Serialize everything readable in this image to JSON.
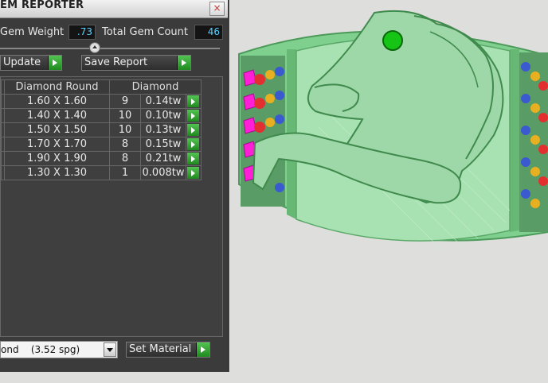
{
  "panel": {
    "title": "EM REPORTER",
    "close": "×",
    "gem_weight_label": "Gem Weight",
    "gem_weight_value": ".73",
    "gem_count_label": "Total Gem Count",
    "gem_count_value": "46",
    "update_label": "Update",
    "save_report_label": "Save Report",
    "table": {
      "headers": [
        "Diamond Round",
        "Diamond"
      ],
      "rows": [
        {
          "size": "1.60 X 1.60",
          "count": "9",
          "weight": "0.14tw"
        },
        {
          "size": "1.40 X 1.40",
          "count": "10",
          "weight": "0.10tw"
        },
        {
          "size": "1.50 X 1.50",
          "count": "10",
          "weight": "0.13tw"
        },
        {
          "size": "1.70 X 1.70",
          "count": "8",
          "weight": "0.15tw"
        },
        {
          "size": "1.90 X 1.90",
          "count": "8",
          "weight": "0.21tw"
        },
        {
          "size": "1.30 X 1.30",
          "count": "1",
          "weight": "0.008tw"
        }
      ]
    },
    "material_value": "ond    (3.52 spg)",
    "set_material_label": "Set Material"
  },
  "colors": {
    "panel_bg": "#3b3b3b",
    "value_text": "#5ad0ff",
    "go_button": "#2fa52f",
    "model_green": "#8fd69a",
    "gem_magenta": "#ff1fd6",
    "gem_green_eye": "#16c416"
  },
  "icons": [
    "close-icon",
    "go-arrow-icon",
    "slider-knob-icon",
    "dropdown-chevron-icon"
  ]
}
